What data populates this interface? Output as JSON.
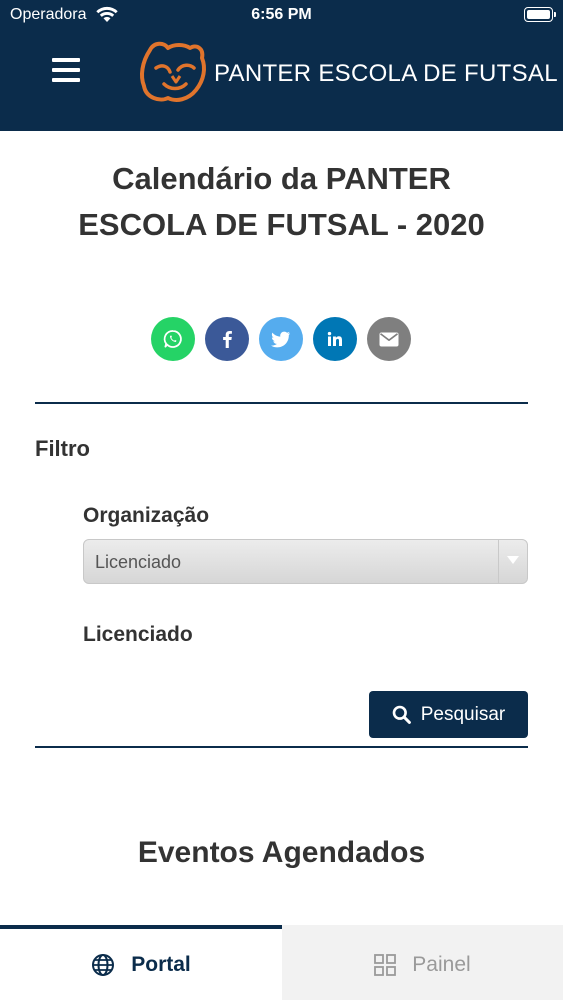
{
  "status_bar": {
    "carrier": "Operadora",
    "time": "6:56 PM"
  },
  "header": {
    "brand_name": "PANTER ESCOLA DE FUTSAL",
    "logo": "panther-head-logo",
    "menu_icon": "hamburger-menu-icon"
  },
  "page": {
    "title": "Calendário da PANTER ESCOLA DE FUTSAL - 2020"
  },
  "share": {
    "items": [
      {
        "icon": "whatsapp-icon",
        "color": "#25d366"
      },
      {
        "icon": "facebook-icon",
        "color": "#3b5998"
      },
      {
        "icon": "twitter-icon",
        "color": "#55acee"
      },
      {
        "icon": "linkedin-icon",
        "color": "#0077b5"
      },
      {
        "icon": "email-icon",
        "color": "#7f7f7f"
      }
    ]
  },
  "filter": {
    "title": "Filtro",
    "organization_label": "Organização",
    "organization_selected": "Licenciado",
    "licensee_label": "Licenciado",
    "search_label": "Pesquisar"
  },
  "events": {
    "title": "Eventos Agendados"
  },
  "tab_bar": {
    "portal_label": "Portal",
    "painel_label": "Painel",
    "active": "portal"
  },
  "colors": {
    "brand_navy": "#0b2c4b",
    "logo_orange": "#e0742c",
    "text_dark": "#333333"
  }
}
